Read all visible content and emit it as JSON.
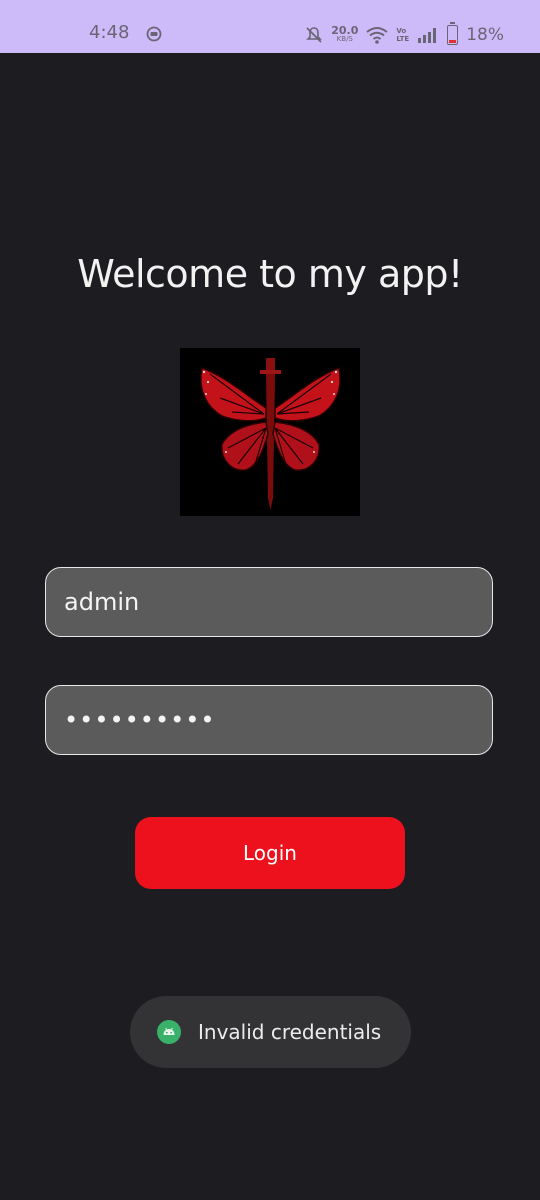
{
  "status_bar": {
    "time": "4:48",
    "net_speed_value": "20.0",
    "net_speed_unit": "KB/S",
    "volte_top": "Vo",
    "volte_bottom": "LTE",
    "battery_percent": "18%",
    "background_color": "#cdbbf9",
    "icons": [
      "app-notification-icon",
      "mute-icon",
      "wifi-icon",
      "signal-icon",
      "battery-icon"
    ]
  },
  "login": {
    "title": "Welcome to my app!",
    "logo_icon": "red-butterfly-dagger-logo",
    "username_value": "admin",
    "password_value": "••••••••••",
    "login_button_label": "Login",
    "accent_color": "#ec111c"
  },
  "toast": {
    "message": "Invalid credentials",
    "icon": "android-app-icon"
  }
}
